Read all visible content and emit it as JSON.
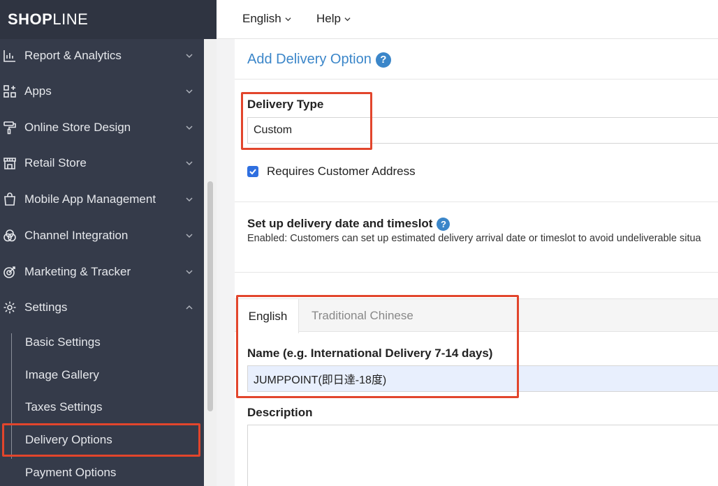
{
  "logo": {
    "brand_bold": "SHOP",
    "brand_thin": "LINE"
  },
  "topbar": {
    "language": "English",
    "help": "Help"
  },
  "sidebar": {
    "items": [
      {
        "label": "Report & Analytics",
        "icon": "chart-icon",
        "expanded": false
      },
      {
        "label": "Apps",
        "icon": "apps-grid-icon",
        "expanded": false
      },
      {
        "label": "Online Store Design",
        "icon": "paint-roller-icon",
        "expanded": false
      },
      {
        "label": "Retail Store",
        "icon": "store-icon",
        "expanded": false
      },
      {
        "label": "Mobile App Management",
        "icon": "shopping-bag-icon",
        "expanded": false
      },
      {
        "label": "Channel Integration",
        "icon": "channels-icon",
        "expanded": false
      },
      {
        "label": "Marketing & Tracker",
        "icon": "target-icon",
        "expanded": false
      },
      {
        "label": "Settings",
        "icon": "gear-icon",
        "expanded": true
      }
    ],
    "sub_items": [
      {
        "label": "Basic Settings"
      },
      {
        "label": "Image Gallery"
      },
      {
        "label": "Taxes Settings"
      },
      {
        "label": "Delivery Options",
        "active": true
      },
      {
        "label": "Payment Options"
      }
    ]
  },
  "page": {
    "title": "Add Delivery Option",
    "delivery_type": {
      "label": "Delivery Type",
      "value": "Custom"
    },
    "requires_address": {
      "label": "Requires Customer Address",
      "checked": true
    },
    "timeslot": {
      "heading": "Set up delivery date and timeslot",
      "description": "Enabled: Customers can set up estimated delivery arrival date or timeslot to avoid undeliverable situa"
    },
    "tabs": [
      {
        "label": "English",
        "active": true
      },
      {
        "label": "Traditional Chinese",
        "active": false
      }
    ],
    "name_field": {
      "label": "Name (e.g. International Delivery 7-14 days)",
      "value": "JUMPPOINT(即日達-18度)"
    },
    "description_field": {
      "label": "Description",
      "value": ""
    }
  },
  "colors": {
    "sidebar_bg": "#353b4a",
    "accent_blue": "#3b86c9",
    "highlight_red": "#e2452c",
    "checkbox_blue": "#2f6fe0"
  }
}
